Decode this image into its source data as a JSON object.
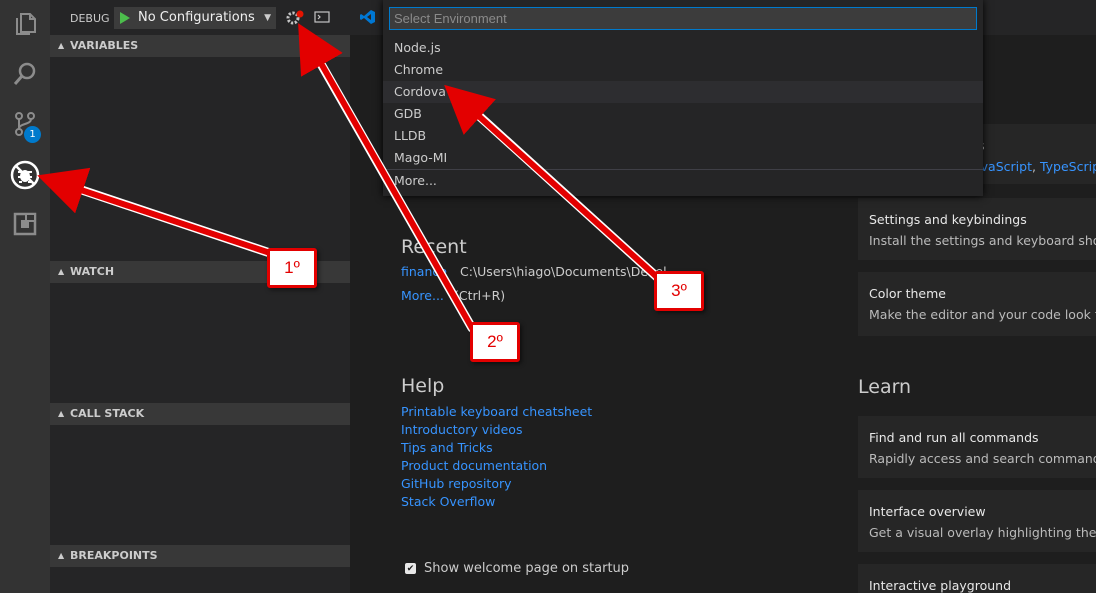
{
  "activity_bar": {
    "icons": [
      "explorer-icon",
      "search-icon",
      "source-control-icon",
      "debug-icon",
      "extensions-icon"
    ],
    "source_control_badge": "1"
  },
  "debug": {
    "label": "DEBUG",
    "config_value": "No Configurations",
    "sections": {
      "variables": "VARIABLES",
      "watch": "WATCH",
      "call_stack": "CALL STACK",
      "breakpoints": "BREAKPOINTS"
    }
  },
  "quick_pick": {
    "placeholder": "Select Environment",
    "items": [
      "Node.js",
      "Chrome",
      "Cordova",
      "GDB",
      "LLDB",
      "Mago-MI",
      "More..."
    ],
    "active_index": 2
  },
  "welcome": {
    "recent_title": "Recent",
    "recent_item_name": "finance",
    "recent_item_path": "C:\\Users\\hiago\\Documents\\Devel",
    "recent_more": "More...",
    "recent_more_shortcut": "(Ctrl+R)",
    "help_title": "Help",
    "help_links": [
      "Printable keyboard cheatsheet",
      "Introductory videos",
      "Tips and Tricks",
      "Product documentation",
      "GitHub repository",
      "Stack Overflow"
    ],
    "customize_partial_title": "s",
    "customize_partial_links": {
      "javascript": "avaScript",
      "sep": ", ",
      "typescript": "TypeScript"
    },
    "cards_top": [
      {
        "title": "Settings and keybindings",
        "desc": "Install the settings and keyboard shortcu"
      },
      {
        "title": "Color theme",
        "desc": "Make the editor and your code look the"
      }
    ],
    "learn_title": "Learn",
    "cards_learn": [
      {
        "title": "Find and run all commands",
        "desc": "Rapidly access and search commands fr"
      },
      {
        "title": "Interface overview",
        "desc": "Get a visual overlay highlighting the ma"
      },
      {
        "title": "Interactive playground",
        "desc": ""
      }
    ],
    "show_on_startup_label": "Show welcome page on startup",
    "show_on_startup_checked": true
  },
  "annotations": {
    "step1": "1º",
    "step2": "2º",
    "step3": "3º",
    "color": "#e30000"
  }
}
